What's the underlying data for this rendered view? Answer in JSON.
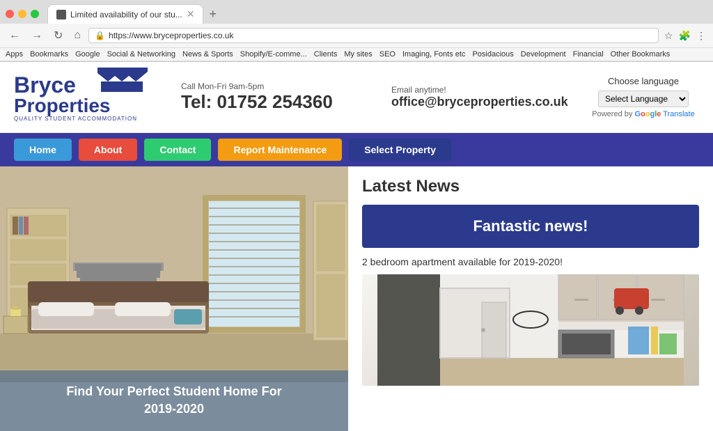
{
  "browser": {
    "tab_title": "Limited availability of our stu...",
    "url": "https://www.bryceproperties.co.uk",
    "new_tab_label": "+",
    "nav_back": "←",
    "nav_forward": "→",
    "nav_refresh": "↻",
    "nav_home": "⌂",
    "bookmarks": {
      "apps": "Apps",
      "bookmarks": "Bookmarks",
      "google": "Google",
      "social": "Social & Networking",
      "news": "News & Sports",
      "shopify": "Shopify/E-comme...",
      "clients": "Clients",
      "my_sites": "My sites",
      "seo": "SEO",
      "imaging": "Imaging, Fonts etc",
      "posidacious": "Posidacious",
      "development": "Development",
      "financial": "Financial",
      "other": "Other Bookmarks"
    }
  },
  "site": {
    "logo": {
      "line1": "Bryce",
      "line2": "Properties",
      "tagline": "QUALITY STUDENT ACCOMMODATION"
    },
    "contact": {
      "call_label": "Call Mon-Fri 9am-5pm",
      "phone": "Tel: 01752 254360",
      "email_label": "Email anytime!",
      "email": "office@bryceproperties.co.uk"
    },
    "translate": {
      "choose_label": "Choose language",
      "select_placeholder": "Select Language",
      "powered_text": "Powered by",
      "google_text": "Google",
      "translate_text": "Translate"
    },
    "nav": {
      "home": "Home",
      "about": "About",
      "contact": "Contact",
      "report": "Report Maintenance",
      "property": "Select Property"
    },
    "main": {
      "caption_line1": "Find Your Perfect Student Home For",
      "caption_line2": "2019-2020",
      "news_title": "Latest News",
      "news_banner": "Fantastic news!",
      "news_subtitle": "2 bedroom apartment available for 2019-2020!"
    }
  }
}
